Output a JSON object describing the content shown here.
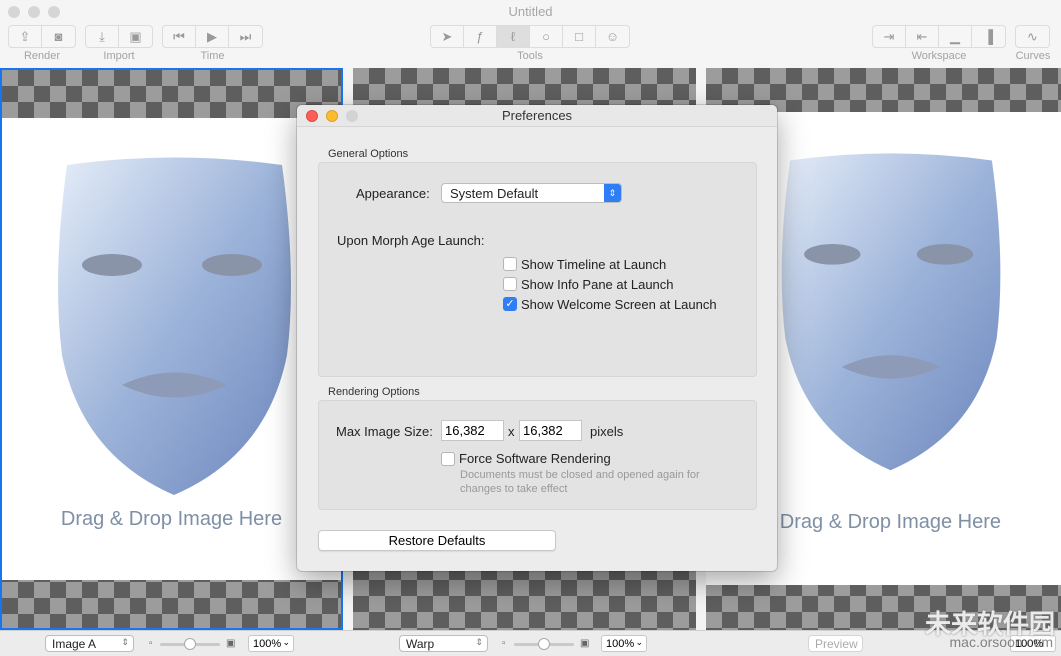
{
  "window": {
    "title": "Untitled"
  },
  "toolbar": {
    "groups": [
      {
        "label": "Render",
        "buttons": [
          "share-icon",
          "camera-icon"
        ]
      },
      {
        "label": "Import",
        "buttons": [
          "import-icon",
          "image-icon"
        ]
      },
      {
        "label": "Time",
        "buttons": [
          "skip-back-icon",
          "play-icon",
          "skip-forward-icon"
        ]
      },
      {
        "label": "Tools",
        "buttons": [
          "arrow-icon",
          "add-point-icon",
          "curve-icon",
          "circle-icon",
          "square-icon",
          "face-icon"
        ],
        "selected": "curve-icon"
      },
      {
        "label": "Workspace",
        "buttons": [
          "expand-right-icon",
          "collapse-left-icon",
          "bottom-pane-icon",
          "right-pane-icon"
        ]
      },
      {
        "label": "Curves",
        "buttons": [
          "curves-icon"
        ]
      }
    ]
  },
  "panels": {
    "left_drop": "Drag & Drop Image Here",
    "right_drop": "Drag & Drop Image Here"
  },
  "bottombar": {
    "image_select": "Image A",
    "zoom_left": "100%",
    "mode_select": "Warp",
    "zoom_mid": "100%",
    "preview_label": "Preview",
    "zoom_right": "100%"
  },
  "preferences": {
    "title": "Preferences",
    "general_label": "General Options",
    "appearance_label": "Appearance:",
    "appearance_value": "System Default",
    "launch_label": "Upon Morph Age Launch:",
    "checkboxes": [
      {
        "label": "Show Timeline at Launch",
        "checked": false
      },
      {
        "label": "Show Info Pane at Launch",
        "checked": false
      },
      {
        "label": "Show Welcome Screen at Launch",
        "checked": true
      }
    ],
    "rendering_label": "Rendering Options",
    "max_size_label": "Max Image Size:",
    "width": "16,382",
    "x_sep": "x",
    "height": "16,382",
    "units": "pixels",
    "force_sw_label": "Force Software Rendering",
    "force_sw_checked": false,
    "force_sw_note": "Documents must be closed and opened again for changes to take effect",
    "restore_label": "Restore Defaults"
  },
  "colors": {
    "accent": "#2f7ef6",
    "selection_border": "#1a73f0"
  },
  "watermark": {
    "text": "未来软件园",
    "url": "mac.orsoon.com"
  }
}
